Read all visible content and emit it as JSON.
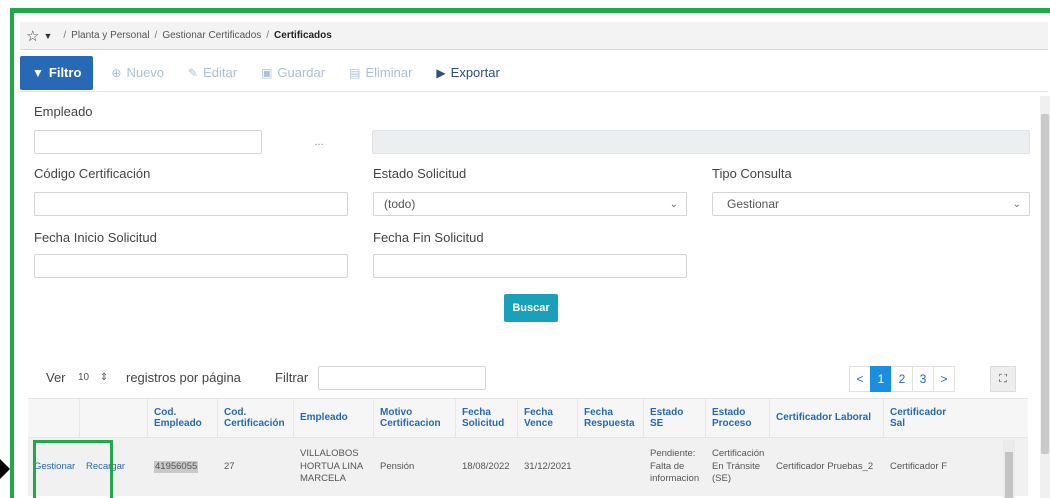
{
  "breadcrumb": {
    "items": [
      "Planta y Personal",
      "Gestionar Certificados"
    ],
    "current": "Certificados"
  },
  "toolbar": {
    "filter": "Filtro",
    "new": "Nuevo",
    "edit": "Editar",
    "save": "Guardar",
    "delete": "Eliminar",
    "export": "Exportar"
  },
  "form": {
    "employee_label": "Empleado",
    "employee_value": "",
    "employee_lookup": "...",
    "cert_code_label": "Código Certificación",
    "status_label": "Estado Solicitud",
    "status_value": "(todo)",
    "query_type_label": "Tipo Consulta",
    "query_type_value": "Gestionar",
    "start_date_label": "Fecha Inicio Solicitud",
    "end_date_label": "Fecha Fin Solicitud",
    "search_button": "Buscar"
  },
  "list_controls": {
    "show_label": "Ver",
    "page_size": "10",
    "per_page_label": "registros por página",
    "filter_label": "Filtrar",
    "pages": [
      "<",
      "1",
      "2",
      "3",
      ">"
    ],
    "active_page": "1"
  },
  "table": {
    "columns": [
      "",
      "",
      "Cod.\nEmpleado",
      "Cod.\nCertificación",
      "Empleado",
      "Motivo\nCertificacion",
      "Fecha\nSolicitud",
      "Fecha\nVence",
      "Fecha\nRespuesta",
      "Estado\nSE",
      "Estado\nProceso",
      "Certificador Laboral",
      "Certificador Sal"
    ],
    "rows": [
      {
        "action1": "Gestionar",
        "action2": "Recargar",
        "emp_code": "41956055",
        "cert_code": "27",
        "employee": "VILLALOBOS\nHORTUA LINA\nMARCELA",
        "reason": "Pensión",
        "request_date": "18/08/2022",
        "due_date": "31/12/2021",
        "response_date": "",
        "se_status": "Pendiente:\nFalta de\ninformacion",
        "process_status": "Certificación\nEn Tránsite\n(SE)",
        "labor_certifier": "Certificador Pruebas_2",
        "salary_certifier": "Certificador F"
      }
    ]
  },
  "colors": {
    "primary": "#2769b5",
    "accent_teal": "#1aa0b8",
    "highlight_green": "#22a84a"
  }
}
